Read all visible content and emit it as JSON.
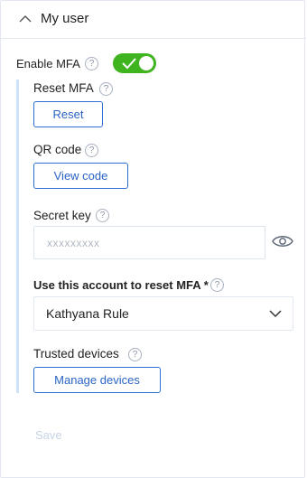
{
  "section": {
    "title": "My user"
  },
  "mfa": {
    "enable_label": "Enable MFA",
    "enabled": true,
    "reset_label": "Reset MFA",
    "reset_button": "Reset",
    "qr_label": "QR code",
    "qr_button": "View code",
    "secret_label": "Secret key",
    "secret_placeholder": "xxxxxxxxx",
    "reset_account_label": "Use this account to reset MFA *",
    "reset_account_value": "Kathyana Rule",
    "trusted_label": "Trusted devices",
    "trusted_button": "Manage devices"
  },
  "help_glyph": "?",
  "footer": {
    "save_label": "Save"
  },
  "colors": {
    "accent": "#2c6fd1",
    "toggle_on": "#3fb41f",
    "indent": "#cfe2f8",
    "save_disabled": "#c7d4e6"
  },
  "icons": [
    "chevron-up-icon",
    "help-icon",
    "check-icon",
    "eye-icon",
    "chevron-down-icon"
  ]
}
